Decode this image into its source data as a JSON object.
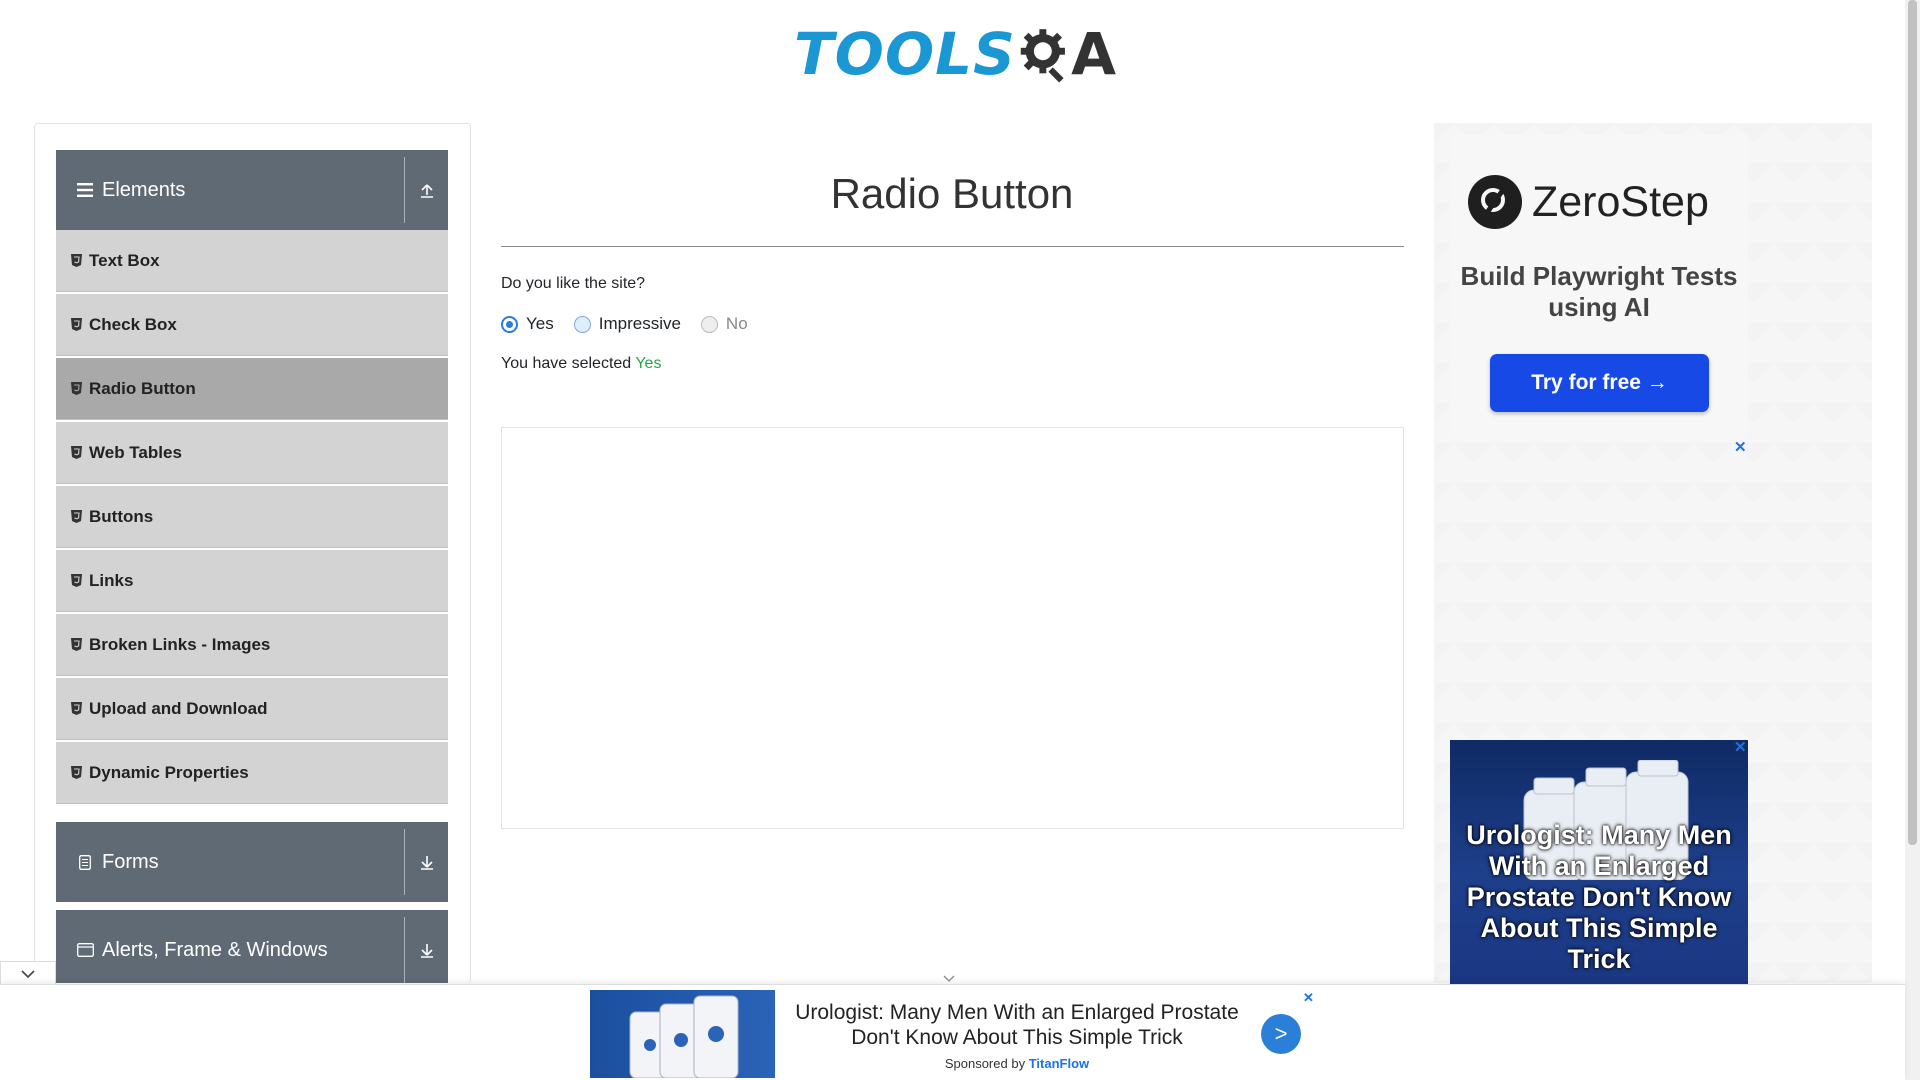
{
  "logo": {
    "left_text": "TOOLS",
    "right_text": "A"
  },
  "sidebar": {
    "groups": [
      {
        "title": "Elements",
        "toggle_icon": "arrow-up-icon"
      },
      {
        "title": "Forms",
        "toggle_icon": "arrow-down-icon"
      },
      {
        "title": "Alerts, Frame & Windows",
        "toggle_icon": "arrow-down-icon"
      }
    ],
    "items": [
      {
        "label": "Text Box"
      },
      {
        "label": "Check Box"
      },
      {
        "label": "Radio Button",
        "active": true
      },
      {
        "label": "Web Tables"
      },
      {
        "label": "Buttons"
      },
      {
        "label": "Links"
      },
      {
        "label": "Broken Links - Images"
      },
      {
        "label": "Upload and Download"
      },
      {
        "label": "Dynamic Properties"
      }
    ]
  },
  "main": {
    "title": "Radio Button",
    "question": "Do you like the site?",
    "options": [
      {
        "label": "Yes",
        "state": "checked"
      },
      {
        "label": "Impressive",
        "state": "unchecked"
      },
      {
        "label": "No",
        "state": "disabled"
      }
    ],
    "selected_prefix": "You have selected",
    "selected_value": "Yes"
  },
  "ads": {
    "zerostep": {
      "brand": "ZeroStep",
      "tagline": "Build Playwright Tests using AI",
      "button": "Try for free →",
      "close": "✕"
    },
    "urologist": {
      "text": "Urologist: Many Men With an Enlarged Prostate Don't Know About This Simple Trick",
      "close": "✕"
    },
    "bottom": {
      "text": "Urologist: Many Men With an Enlarged Prostate Don't Know About This Simple Trick",
      "sponsored_prefix": "Sponsored by",
      "sponsor": "TitanFlow",
      "go": ">",
      "close": "✕"
    }
  },
  "colors": {
    "sidebar_header": "#5f6a75",
    "sidebar_item": "#d3d3d3",
    "sidebar_item_active": "#a9a9a9",
    "selected_value": "#28a745",
    "radio_accent": "#2a7bdc",
    "logo_blue": "#1b97d4"
  }
}
